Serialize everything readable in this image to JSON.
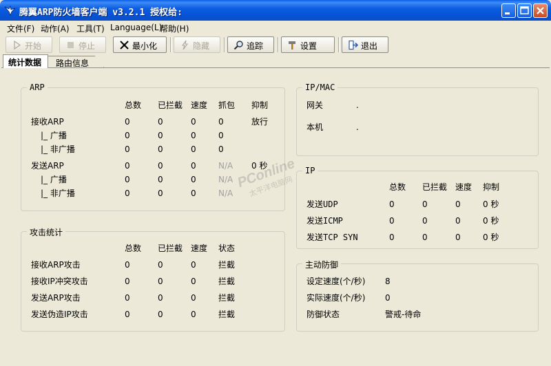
{
  "window": {
    "title": "腾翼ARP防火墙客户端 v3.2.1  授权给:"
  },
  "menu": [
    "文件(F)",
    "动作(A)",
    "工具(T)",
    "Language(L)",
    "帮助(H)"
  ],
  "toolbar": {
    "start": "开始",
    "stop": "停止",
    "minimize": "最小化",
    "hide": "隐藏",
    "trace": "追踪",
    "settings": "设置",
    "exit": "退出"
  },
  "tabs": {
    "stats": "统计数据",
    "route": "路由信息"
  },
  "arp": {
    "title": "ARP",
    "headers": [
      "总数",
      "已拦截",
      "速度",
      "抓包",
      "抑制"
    ],
    "rows": [
      {
        "label": "接收ARP",
        "values": [
          "0",
          "0",
          "0",
          "0",
          "放行"
        ]
      },
      {
        "label": "|_ 广播",
        "values": [
          "0",
          "0",
          "0",
          "0",
          ""
        ]
      },
      {
        "label": "|_ 非广播",
        "values": [
          "0",
          "0",
          "0",
          "0",
          ""
        ]
      },
      {
        "label": "发送ARP",
        "values": [
          "0",
          "0",
          "0",
          "N/A",
          "0 秒"
        ]
      },
      {
        "label": "|_ 广播",
        "values": [
          "0",
          "0",
          "0",
          "N/A",
          ""
        ]
      },
      {
        "label": "|_ 非广播",
        "values": [
          "0",
          "0",
          "0",
          "N/A",
          ""
        ]
      }
    ]
  },
  "ipmac": {
    "title": "IP/MAC",
    "gateway_label": "网关",
    "gateway_value": ".",
    "local_label": "本机",
    "local_value": "."
  },
  "ip": {
    "title": "IP",
    "headers": [
      "总数",
      "已拦截",
      "速度",
      "抑制"
    ],
    "rows": [
      {
        "label": "发送UDP",
        "values": [
          "0",
          "0",
          "0",
          "0 秒"
        ]
      },
      {
        "label": "发送ICMP",
        "values": [
          "0",
          "0",
          "0",
          "0 秒"
        ]
      },
      {
        "label": "发送TCP SYN",
        "values": [
          "0",
          "0",
          "0",
          "0 秒"
        ]
      }
    ]
  },
  "attack": {
    "title": "攻击统计",
    "headers": [
      "总数",
      "已拦截",
      "速度",
      "状态"
    ],
    "rows": [
      {
        "label": "接收ARP攻击",
        "values": [
          "0",
          "0",
          "0",
          "拦截"
        ]
      },
      {
        "label": "接收IP冲突攻击",
        "values": [
          "0",
          "0",
          "0",
          "拦截"
        ]
      },
      {
        "label": "发送ARP攻击",
        "values": [
          "0",
          "0",
          "0",
          "拦截"
        ]
      },
      {
        "label": "发送伪造IP攻击",
        "values": [
          "0",
          "0",
          "0",
          "拦截"
        ]
      }
    ]
  },
  "defense": {
    "title": "主动防御",
    "set_speed_label": "设定速度(个/秒)",
    "set_speed_value": "8",
    "actual_speed_label": "实际速度(个/秒)",
    "actual_speed_value": "0",
    "status_label": "防御状态",
    "status_value": "警戒-待命"
  },
  "watermark": {
    "text": "PConline",
    "subtext": "太平洋电脑网"
  }
}
